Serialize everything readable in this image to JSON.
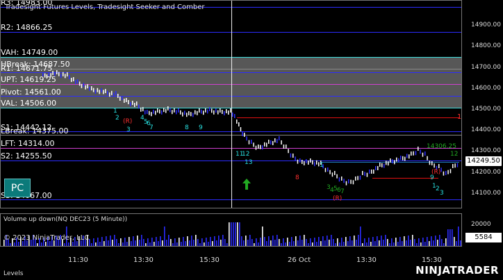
{
  "chart": {
    "title": "Tradesight Futures Levels, Tradesight Seeker and Comber",
    "levels": [
      {
        "text": "R3: 14983.00",
        "color": "#2c2cff"
      },
      {
        "text": "R2: 14866.25",
        "color": "#2c2cff"
      },
      {
        "text": "VAH: 14749.00",
        "color": "#40e0e0"
      },
      {
        "text": "HBreak: 14687.50",
        "color": "#c0c0c0"
      },
      {
        "text": "R1: 14671.75",
        "color": "#2c2cff"
      },
      {
        "text": "UPT: 14619.25",
        "color": "#ff40ff"
      },
      {
        "text": "Pivot: 14561.00",
        "color": "#2c2cff"
      },
      {
        "text": "VAL: 14506.00",
        "color": "#40e0e0"
      },
      {
        "text": "S1: 14442.12",
        "color": "#2c2cff"
      },
      {
        "text": "LBreak: 14375.00",
        "color": "#c0c0c0"
      },
      {
        "text": "LFT: 14314.00",
        "color": "#ff40ff"
      },
      {
        "text": "S2: 14255.50",
        "color": "#2c2cff"
      },
      {
        "text": "S3: 14067.00",
        "color": "#2c2cff"
      }
    ],
    "price_axis": [
      "14900.00",
      "14800.00",
      "14700.00",
      "14600.00",
      "14500.00",
      "14400.00",
      "14300.00",
      "14200.00",
      "14100.00"
    ],
    "current_price": "14249.50",
    "right_markers": [
      "1",
      "12"
    ],
    "annotations": [
      "(R)",
      "(R)",
      "(R)",
      "14306.25"
    ],
    "seq_numbers": [
      "1",
      "2",
      "3",
      "4",
      "5",
      "6",
      "7",
      "8",
      "9",
      "11",
      "12",
      "13",
      "1",
      "3",
      "4",
      "5",
      "6",
      "7",
      "8",
      "9",
      "1",
      "2",
      "3",
      "4",
      "5",
      "6"
    ],
    "pc_label": "PC"
  },
  "volume": {
    "title": "Volume up down(NQ DEC23 (5 Minute))",
    "axis": [
      "20000"
    ],
    "current": "5584"
  },
  "time_axis": [
    "11:30",
    "13:30",
    "15:30",
    "26 Oct",
    "13:30",
    "15:30"
  ],
  "footer": {
    "copyright": "© 2023 NinjaTrader, LLC",
    "levels_text": "Levels",
    "logo": "NINJATRADER"
  },
  "colors": {
    "bull": "#ffffff",
    "bear": "#2c2cff",
    "seq_green": "#22aa22",
    "seq_cyan": "#28e0e0",
    "seq_red": "#ff3030",
    "shade": "#555555"
  }
}
